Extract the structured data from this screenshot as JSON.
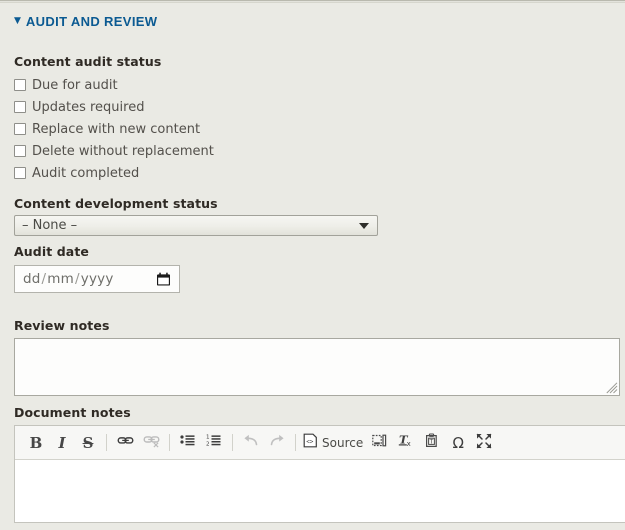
{
  "section": {
    "title": "AUDIT AND REVIEW",
    "collapse_icon": "triangle-down-icon",
    "accent_color": "#0b5a92",
    "expanded": true
  },
  "background_color": "#eaeae4",
  "content_audit_status": {
    "label": "Content audit status",
    "options": [
      {
        "label": "Due for audit",
        "checked": false
      },
      {
        "label": "Updates required",
        "checked": false
      },
      {
        "label": "Replace with new content",
        "checked": false
      },
      {
        "label": "Delete without replacement",
        "checked": false
      },
      {
        "label": "Audit completed",
        "checked": false
      }
    ]
  },
  "content_development_status": {
    "label": "Content development status",
    "selected": "– None –",
    "options": [
      "– None –"
    ],
    "arrow_icon": "chevron-down-icon"
  },
  "audit_date": {
    "label": "Audit date",
    "value": "",
    "placeholder_day": "dd",
    "placeholder_month": "mm",
    "placeholder_year": "yyyy",
    "separator": "/",
    "picker_icon": "calendar-icon"
  },
  "review_notes": {
    "label": "Review notes",
    "value": "",
    "placeholder": ""
  },
  "document_notes": {
    "label": "Document notes",
    "value": "",
    "toolbar": [
      {
        "name": "bold",
        "icon": "bold-icon",
        "glyph": "B",
        "label": "",
        "disabled": false,
        "sep_after": false
      },
      {
        "name": "italic",
        "icon": "italic-icon",
        "glyph": "I",
        "label": "",
        "disabled": false,
        "sep_after": false
      },
      {
        "name": "strikethrough",
        "icon": "strikethrough-icon",
        "glyph": "S",
        "label": "",
        "disabled": false,
        "sep_after": true
      },
      {
        "name": "link",
        "icon": "link-icon",
        "glyph": "",
        "label": "",
        "disabled": false,
        "sep_after": false
      },
      {
        "name": "unlink",
        "icon": "unlink-icon",
        "glyph": "",
        "label": "",
        "disabled": true,
        "sep_after": true
      },
      {
        "name": "bulleted-list",
        "icon": "bulleted-list-icon",
        "glyph": "",
        "label": "",
        "disabled": false,
        "sep_after": false
      },
      {
        "name": "numbered-list",
        "icon": "numbered-list-icon",
        "glyph": "",
        "label": "",
        "disabled": false,
        "sep_after": true
      },
      {
        "name": "undo",
        "icon": "undo-arrow-icon",
        "glyph": "",
        "label": "",
        "disabled": true,
        "sep_after": false
      },
      {
        "name": "redo",
        "icon": "redo-arrow-icon",
        "glyph": "",
        "label": "",
        "disabled": true,
        "sep_after": true
      },
      {
        "name": "source",
        "icon": "source-code-icon",
        "glyph": "",
        "label": "Source",
        "disabled": false,
        "sep_after": false
      },
      {
        "name": "insert-media",
        "icon": "image-media-icon",
        "glyph": "",
        "label": "",
        "disabled": false,
        "sep_after": false
      },
      {
        "name": "remove-format",
        "icon": "remove-format-icon",
        "glyph": "",
        "label": "",
        "disabled": false,
        "sep_after": false
      },
      {
        "name": "paste-as-text",
        "icon": "paste-text-icon",
        "glyph": "",
        "label": "",
        "disabled": false,
        "sep_after": false
      },
      {
        "name": "special-char",
        "icon": "omega-icon",
        "glyph": "Ω",
        "label": "",
        "disabled": false,
        "sep_after": false
      },
      {
        "name": "maximize",
        "icon": "maximize-icon",
        "glyph": "",
        "label": "",
        "disabled": false,
        "sep_after": false
      }
    ]
  }
}
